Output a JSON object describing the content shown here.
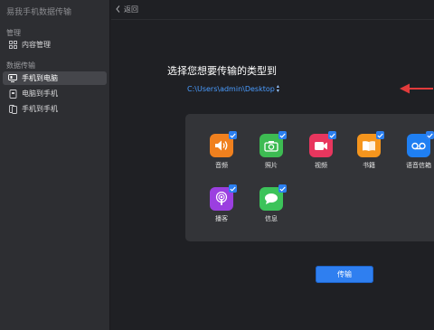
{
  "app": {
    "title": "易我手机数据传输"
  },
  "sidebar": {
    "sections": [
      {
        "label": "管理",
        "items": [
          {
            "label": "内容管理",
            "icon": "grid-icon",
            "active": false
          }
        ]
      },
      {
        "label": "数据传输",
        "items": [
          {
            "label": "手机到电脑",
            "icon": "phone-to-pc-icon",
            "active": true
          },
          {
            "label": "电脑到手机",
            "icon": "pc-to-phone-icon",
            "active": false
          },
          {
            "label": "手机到手机",
            "icon": "phone-to-phone-icon",
            "active": false
          }
        ]
      }
    ]
  },
  "topbar": {
    "back_label": "返回"
  },
  "main": {
    "heading": "选择您想要传输的类型到",
    "path": "C:\\Users\\admin\\Desktop",
    "types": [
      {
        "label": "音频",
        "icon": "audio-icon",
        "color": "#f0801e",
        "checked": true
      },
      {
        "label": "照片",
        "icon": "camera-icon",
        "color": "#3dbb52",
        "checked": true
      },
      {
        "label": "视频",
        "icon": "video-icon",
        "color": "#e8365e",
        "checked": true
      },
      {
        "label": "书籍",
        "icon": "book-icon",
        "color": "#f5951d",
        "checked": true
      },
      {
        "label": "语音信箱",
        "icon": "voicemail-icon",
        "color": "#1f7ff2",
        "checked": true
      },
      {
        "label": "播客",
        "icon": "podcast-icon",
        "color": "#9b3fe0",
        "checked": true
      },
      {
        "label": "信息",
        "icon": "message-icon",
        "color": "#3cc35a",
        "checked": true
      }
    ],
    "transfer_label": "传输"
  },
  "colors": {
    "accent": "#2f7ff0",
    "path_link": "#4a9cff",
    "annotation": "#e23b3b"
  }
}
